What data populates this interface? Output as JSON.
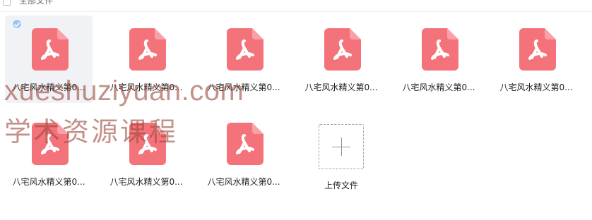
{
  "header": {
    "select_all_label": "全部文件"
  },
  "files": [
    {
      "name": "八宅风水精义第0...",
      "selected": true,
      "icon": "pdf-file-icon"
    },
    {
      "name": "八宅风水精义第0...",
      "selected": false,
      "icon": "pdf-file-icon"
    },
    {
      "name": "八宅风水精义第0...",
      "selected": false,
      "icon": "pdf-file-icon"
    },
    {
      "name": "八宅风水精义第0...",
      "selected": false,
      "icon": "pdf-file-icon"
    },
    {
      "name": "八宅风水精义第0...",
      "selected": false,
      "icon": "pdf-file-icon"
    },
    {
      "name": "八宅风水精义第0...",
      "selected": false,
      "icon": "pdf-file-icon"
    },
    {
      "name": "八宅风水精义第0...",
      "selected": false,
      "icon": "pdf-file-icon"
    },
    {
      "name": "八宅风水精义第0...",
      "selected": false,
      "icon": "pdf-file-icon"
    },
    {
      "name": "八宅风水精义第0...",
      "selected": false,
      "icon": "pdf-file-icon"
    }
  ],
  "upload": {
    "label": "上传文件",
    "icon": "plus-icon"
  },
  "watermark": {
    "line1": "xueshuziyuan.com",
    "line2": "学术资源课程"
  },
  "colors": {
    "pdf_red": "#f4727a",
    "selected_bg": "#f1f2f6",
    "check_blue": "#9cc7f0"
  }
}
